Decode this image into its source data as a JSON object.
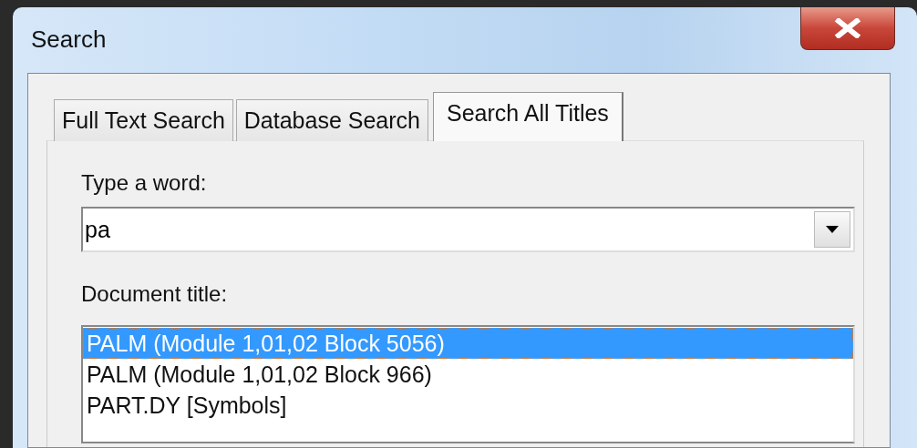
{
  "window": {
    "title": "Search"
  },
  "tabs": [
    {
      "label": "Full Text Search",
      "selected": false
    },
    {
      "label": "Database Search",
      "selected": false
    },
    {
      "label": "Search All Titles",
      "selected": true
    }
  ],
  "word_field": {
    "label": "Type a word:",
    "value": "pa"
  },
  "document_list": {
    "label": "Document title:",
    "items": [
      {
        "text": "PALM (Module 1,01,02 Block 5056)",
        "selected": true
      },
      {
        "text": "PALM (Module 1,01,02 Block 966)",
        "selected": false
      },
      {
        "text": "PART.DY [Symbols]",
        "selected": false
      }
    ]
  }
}
